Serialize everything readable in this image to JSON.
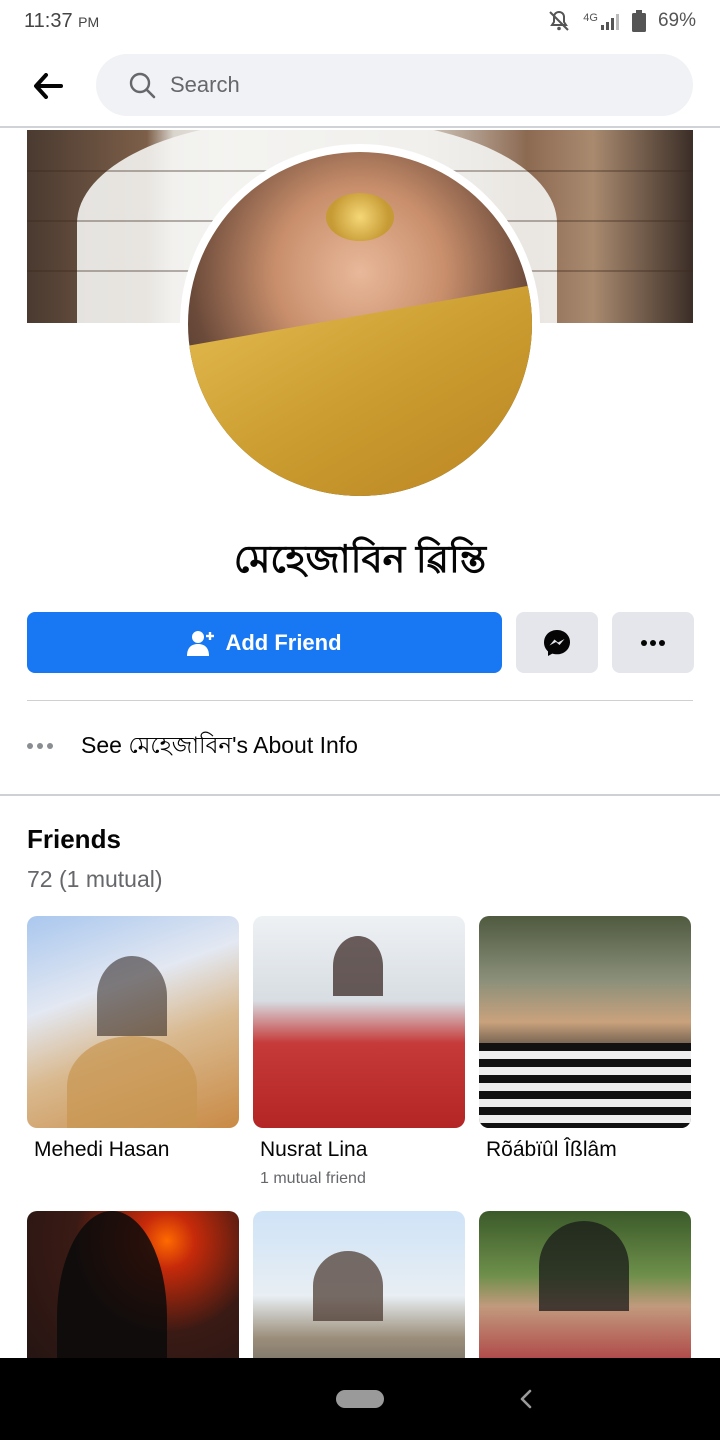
{
  "status_bar": {
    "time": "11:37",
    "ampm": "PM",
    "network": "4G",
    "battery": "69%"
  },
  "top_nav": {
    "search_placeholder": "Search"
  },
  "profile": {
    "name": "মেহেজাবিন ৱিন্তি",
    "add_friend_label": "Add Friend",
    "about_text": "See মেহেজাবিন's About Info"
  },
  "friends": {
    "title": "Friends",
    "count": "72 (1 mutual)",
    "items": [
      {
        "name": "Mehedi Hasan",
        "mutual": ""
      },
      {
        "name": "Nusrat Lina",
        "mutual": "1 mutual friend"
      },
      {
        "name": "Rõábïûl Îßlâm",
        "mutual": ""
      },
      {
        "name": "",
        "mutual": ""
      },
      {
        "name": "",
        "mutual": ""
      },
      {
        "name": "",
        "mutual": ""
      }
    ]
  },
  "colors": {
    "primary": "#1877f2",
    "button_gray": "#e4e6eb",
    "secondary_text": "#65676b"
  },
  "icons": [
    "back-arrow-icon",
    "search-icon",
    "add-person-icon",
    "messenger-icon",
    "more-dots-icon",
    "mute-bell-icon",
    "signal-icon",
    "battery-icon"
  ]
}
